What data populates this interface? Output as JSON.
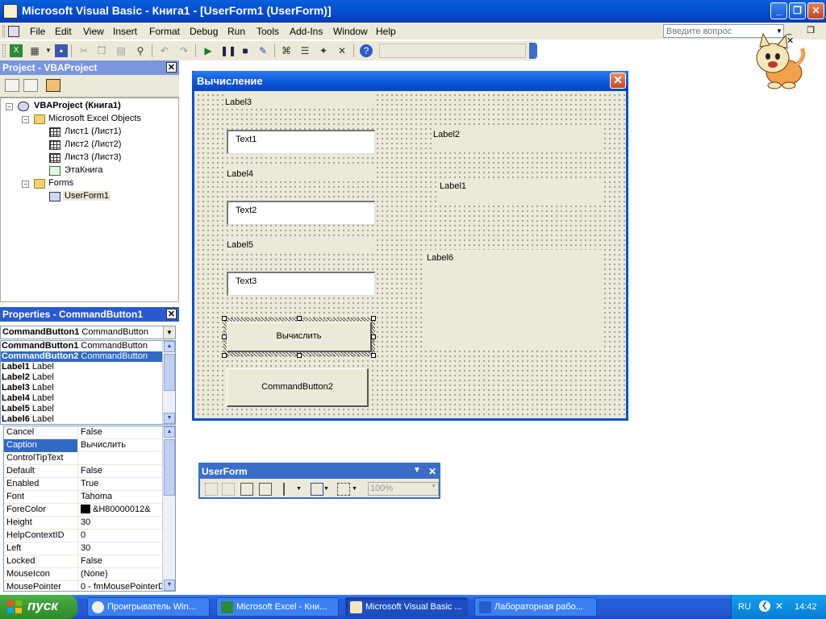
{
  "window": {
    "title": "Microsoft Visual Basic - Книга1 - [UserForm1 (UserForm)]",
    "minimize_glyph": "_",
    "maximize_glyph": "❐",
    "close_glyph": "✕"
  },
  "menubar": {
    "items": [
      "File",
      "Edit",
      "View",
      "Insert",
      "Format",
      "Debug",
      "Run",
      "Tools",
      "Add-Ins",
      "Window",
      "Help"
    ],
    "ask_placeholder": "Введите вопрос",
    "mdi_buttons": "_ ❐ ✕"
  },
  "project": {
    "title": "Project - VBAProject",
    "close_glyph": "✕",
    "tree": {
      "root": "VBAProject (Книга1)",
      "excel_objects": "Microsoft Excel Objects",
      "sheet1": "Лист1 (Лист1)",
      "sheet2": "Лист2 (Лист2)",
      "sheet3": "Лист3 (Лист3)",
      "workbook": "ЭтаКнига",
      "forms": "Forms",
      "userform": "UserForm1"
    }
  },
  "properties": {
    "title": "Properties - CommandButton1",
    "close_glyph": "✕",
    "combo": {
      "name": "CommandButton1",
      "type": "CommandButton"
    },
    "objects": [
      {
        "name": "CommandButton1",
        "type": "CommandButton"
      },
      {
        "name": "CommandButton2",
        "type": "CommandButton"
      },
      {
        "name": "Label1",
        "type": "Label"
      },
      {
        "name": "Label2",
        "type": "Label"
      },
      {
        "name": "Label3",
        "type": "Label"
      },
      {
        "name": "Label4",
        "type": "Label"
      },
      {
        "name": "Label5",
        "type": "Label"
      },
      {
        "name": "Label6",
        "type": "Label"
      }
    ],
    "grid": [
      {
        "name": "Cancel",
        "value": "False"
      },
      {
        "name": "Caption",
        "value": "Вычислить"
      },
      {
        "name": "ControlTipText",
        "value": ""
      },
      {
        "name": "Default",
        "value": "False"
      },
      {
        "name": "Enabled",
        "value": "True"
      },
      {
        "name": "Font",
        "value": "Tahoma"
      },
      {
        "name": "ForeColor",
        "value": "&H80000012&"
      },
      {
        "name": "Height",
        "value": "30"
      },
      {
        "name": "HelpContextID",
        "value": "0"
      },
      {
        "name": "Left",
        "value": "30"
      },
      {
        "name": "Locked",
        "value": "False"
      },
      {
        "name": "MouseIcon",
        "value": "(None)"
      },
      {
        "name": "MousePointer",
        "value": "0 - fmMousePointerD"
      }
    ]
  },
  "userform": {
    "title": "Вычисление",
    "label3": "Label3",
    "text1": "Text1",
    "label2": "Label2",
    "label4": "Label4",
    "label1": "Label1",
    "text2": "Text2",
    "label5": "Label5",
    "label6": "Label6",
    "text3": "Text3",
    "button1": "Вычислить",
    "button2": "CommandButton2"
  },
  "toolbox": {
    "title": "UserForm",
    "zoom": "100%"
  },
  "taskbar": {
    "start": "пуск",
    "tasks": [
      "Проигрыватель Win...",
      "Microsoft Excel - Кни...",
      "Microsoft Visual Basic ...",
      "Лабораторная рабо..."
    ],
    "lang": "RU",
    "clock": "14:42"
  },
  "colors": {
    "title_blue": "#0a5fd8",
    "selection_blue": "#316ac5",
    "face": "#ece9d8",
    "start_green": "#3a9a36"
  }
}
